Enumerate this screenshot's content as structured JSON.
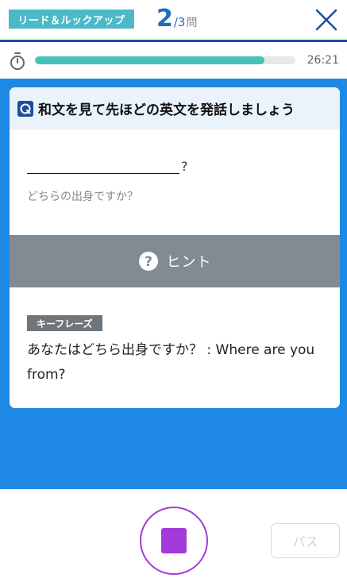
{
  "header": {
    "mode_badge": "リード＆ルックアップ",
    "question_current": "2",
    "question_total": "/3",
    "question_unit": "問",
    "close_icon": "close-icon"
  },
  "timer": {
    "icon": "stopwatch-icon",
    "progress_fraction": 0.88,
    "time_left": "26:21"
  },
  "card": {
    "title_icon": "q-icon",
    "title": "和文を見て先ほどの英文を発話しましょう",
    "answer_suffix": "?",
    "japanese_question": "どちらの出身ですか？",
    "hint": {
      "icon": "question-circle-icon",
      "label": "ヒント"
    },
    "key_phrase": {
      "tag": "キーフレーズ",
      "text": "あなたはどちら出身ですか？ : Where are you from?"
    }
  },
  "controls": {
    "stop_icon": "stop-icon",
    "pass_label": "パス"
  },
  "colors": {
    "accent_blue": "#1e88e5",
    "badge_teal": "#4bb9c8",
    "progress_teal": "#46c1b7",
    "record_purple": "#a23ad9",
    "hint_gray": "#838b92"
  }
}
